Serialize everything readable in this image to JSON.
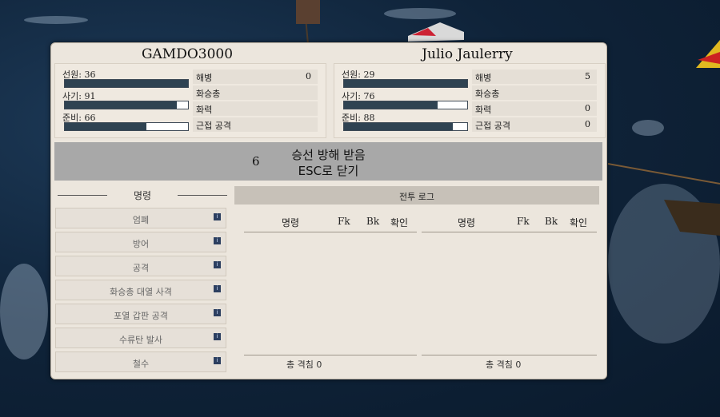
{
  "players": [
    {
      "name": "GAMDO3000",
      "crew_label": "선원: 36",
      "crew_fill": 1.0,
      "morale_label": "사기: 91",
      "morale_fill": 0.91,
      "prep_label": "준비: 66",
      "prep_fill": 0.66,
      "rows": [
        {
          "label": "해병",
          "value": "0"
        },
        {
          "label": "화승총",
          "value": ""
        },
        {
          "label": "화력",
          "value": ""
        },
        {
          "label": "근접 공격",
          "value": ""
        }
      ]
    },
    {
      "name": "Julio Jaulerry",
      "crew_label": "선원: 29",
      "crew_fill": 1.0,
      "morale_label": "사기: 76",
      "morale_fill": 0.76,
      "prep_label": "준비: 88",
      "prep_fill": 0.88,
      "rows": [
        {
          "label": "해병",
          "value": "5"
        },
        {
          "label": "화승총",
          "value": ""
        },
        {
          "label": "화력",
          "value": "0"
        },
        {
          "label": "근접 공격",
          "value": "0"
        }
      ]
    }
  ],
  "banner": {
    "number": "6",
    "line1": "승선 방해 받음",
    "line2": "ESC로 닫기"
  },
  "commands": {
    "title": "명령",
    "items": [
      "엄폐",
      "방어",
      "공격",
      "화승총 대열 사격",
      "포열 갑판 공격",
      "수류탄 발사",
      "철수"
    ]
  },
  "log": {
    "title": "전투 로그",
    "columns": [
      "명령",
      "Fk",
      "Bk",
      "확인"
    ],
    "total_label": "총 격침 0"
  },
  "colors": {
    "panel": "#ece6dd",
    "bar_fill": "#2f4352",
    "banner": "#a8a8a8",
    "accent_icon": "#2c3f60"
  },
  "icons": {
    "info": "info-icon"
  }
}
